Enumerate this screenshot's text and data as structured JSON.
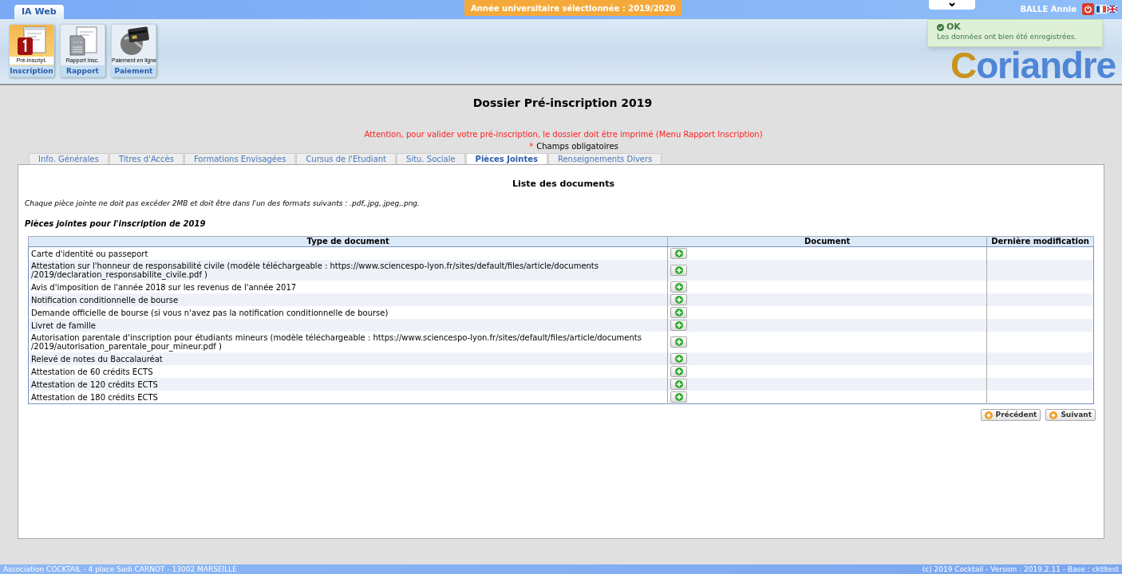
{
  "app_tab": {
    "label": "IA Web",
    "selected": true
  },
  "year_banner": "Année universitaire sélectionnée : 2019/2020",
  "user": {
    "name": "BALLE Annie"
  },
  "languages": [
    {
      "kind": "french",
      "selected": true
    },
    {
      "kind": "british",
      "selected": false
    }
  ],
  "toolbar": [
    {
      "icon_label": "Pré-Inscript.",
      "group": "Inscription",
      "selected": true,
      "kind": "form"
    },
    {
      "icon_label": "Rapport Insc.",
      "group": "Rapport",
      "selected": false,
      "kind": "report"
    },
    {
      "icon_label": "Paiement en ligne",
      "group": "Paiement",
      "selected": false,
      "kind": "payment"
    }
  ],
  "logo": "Coriandre",
  "toast": {
    "title": "OK",
    "message": "Les données ont bien été enregistrées."
  },
  "page_title": "Dossier Pré-inscription 2019",
  "warning": "Attention, pour valider votre pré-inscription, le dossier doit être imprimé (Menu Rapport Inscription)",
  "required_note": {
    "mark": "*",
    "text": "Champs obligatoires"
  },
  "tabs": [
    {
      "label": "Info. Générales",
      "selected": false
    },
    {
      "label": "Titres d'Accès",
      "selected": false
    },
    {
      "label": "Formations Envisagées",
      "selected": false
    },
    {
      "label": "Cursus de l'Etudiant",
      "selected": false
    },
    {
      "label": "Situ. Sociale",
      "selected": false
    },
    {
      "label": "Pièces Jointes",
      "selected": true
    },
    {
      "label": "Renseignements Divers",
      "selected": false
    }
  ],
  "section_title": "Liste des documents",
  "info": "Chaque pièce jointe ne doit pas excéder 2MB et doit être dans l'un des formats suivants : .pdf,.jpg,.jpeg,.png.",
  "subtitle": "Pièces jointes pour l'inscription de 2019",
  "table": {
    "columns": [
      "Type de document",
      "Document",
      "Dernière modification"
    ],
    "rows": [
      {
        "type": "Carte d'identité ou passeport"
      },
      {
        "type": "Attestation sur l'honneur de responsabilité civile (modèle téléchargeable : https://www.sciencespo-lyon.fr/sites/default/files/article/documents /2019/declaration_responsabilite_civile.pdf )"
      },
      {
        "type": "Avis d'imposition de l'année 2018 sur les revenus de l'année 2017"
      },
      {
        "type": "Notification conditionnelle de bourse"
      },
      {
        "type": "Demande officielle de bourse (si vous n'avez pas la notification conditionnelle de bourse)"
      },
      {
        "type": "Livret de famille"
      },
      {
        "type": "Autorisation parentale d'inscription pour étudiants mineurs (modèle téléchargeable : https://www.sciencespo-lyon.fr/sites/default/files/article/documents /2019/autorisation_parentale_pour_mineur.pdf )"
      },
      {
        "type": "Relevé de notes du Baccalauréat"
      },
      {
        "type": "Attestation de 60 crédits ECTS"
      },
      {
        "type": "Attestation de 120 crédits ECTS"
      },
      {
        "type": "Attestation de 180 crédits ECTS"
      }
    ]
  },
  "nav_buttons": [
    {
      "label": "Précédent",
      "kind": "prev"
    },
    {
      "label": "Suivant",
      "kind": "next"
    }
  ],
  "status_bar": {
    "left": "Association COCKTAIL - 4 place Sadi CARNOT - 13002 MARSEILLE",
    "right": "(c) 2019 Cocktail - Version : 2019.2.11 - Base : cktltest"
  }
}
